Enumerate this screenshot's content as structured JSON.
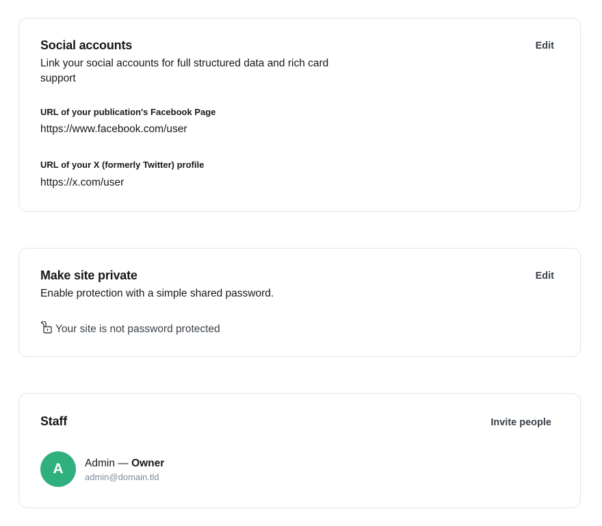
{
  "social": {
    "title": "Social accounts",
    "description": "Link your social accounts for full structured data and rich card support",
    "edit_label": "Edit",
    "facebook_label": "URL of your publication's Facebook Page",
    "facebook_value": "https://www.facebook.com/user",
    "x_label": "URL of your X (formerly Twitter) profile",
    "x_value": "https://x.com/user"
  },
  "private": {
    "title": "Make site private",
    "description": "Enable protection with a simple shared password.",
    "edit_label": "Edit",
    "status_icon": "unlock-icon",
    "status_text": "Your site is not password protected"
  },
  "staff": {
    "title": "Staff",
    "invite_label": "Invite people",
    "members": [
      {
        "initial": "A",
        "name": "Admin",
        "separator": " — ",
        "role": "Owner",
        "email": "admin@domain.tld",
        "avatar_color": "#30b07e"
      }
    ]
  }
}
